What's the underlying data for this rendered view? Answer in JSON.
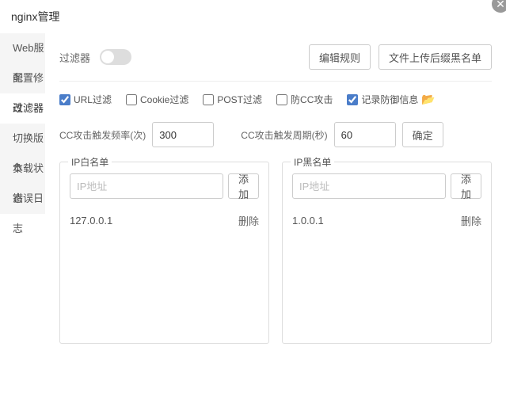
{
  "title": "nginx管理",
  "sidebar": {
    "items": [
      {
        "label": "Web服务"
      },
      {
        "label": "配置修改"
      },
      {
        "label": "过滤器"
      },
      {
        "label": "切换版本"
      },
      {
        "label": "负载状态"
      },
      {
        "label": "错误日志"
      }
    ],
    "activeIndex": 2
  },
  "filter": {
    "label": "过滤器",
    "enabled": false,
    "editRules": "编辑规则",
    "uploadBlacklist": "文件上传后缀黑名单"
  },
  "checks": {
    "url": {
      "label": "URL过滤",
      "checked": true
    },
    "cookie": {
      "label": "Cookie过滤",
      "checked": false
    },
    "post": {
      "label": "POST过滤",
      "checked": false
    },
    "cc": {
      "label": "防CC攻击",
      "checked": false
    },
    "log": {
      "label": "记录防御信息",
      "checked": true
    }
  },
  "cc": {
    "freqLabel": "CC攻击触发频率(次)",
    "freqValue": "300",
    "periodLabel": "CC攻击触发周期(秒)",
    "periodValue": "60",
    "confirm": "确定"
  },
  "whitelist": {
    "title": "IP白名单",
    "placeholder": "IP地址",
    "addLabel": "添加",
    "items": [
      {
        "ip": "127.0.0.1"
      }
    ],
    "deleteLabel": "删除"
  },
  "blacklist": {
    "title": "IP黑名单",
    "placeholder": "IP地址",
    "addLabel": "添加",
    "items": [
      {
        "ip": "1.0.0.1"
      }
    ],
    "deleteLabel": "删除"
  }
}
